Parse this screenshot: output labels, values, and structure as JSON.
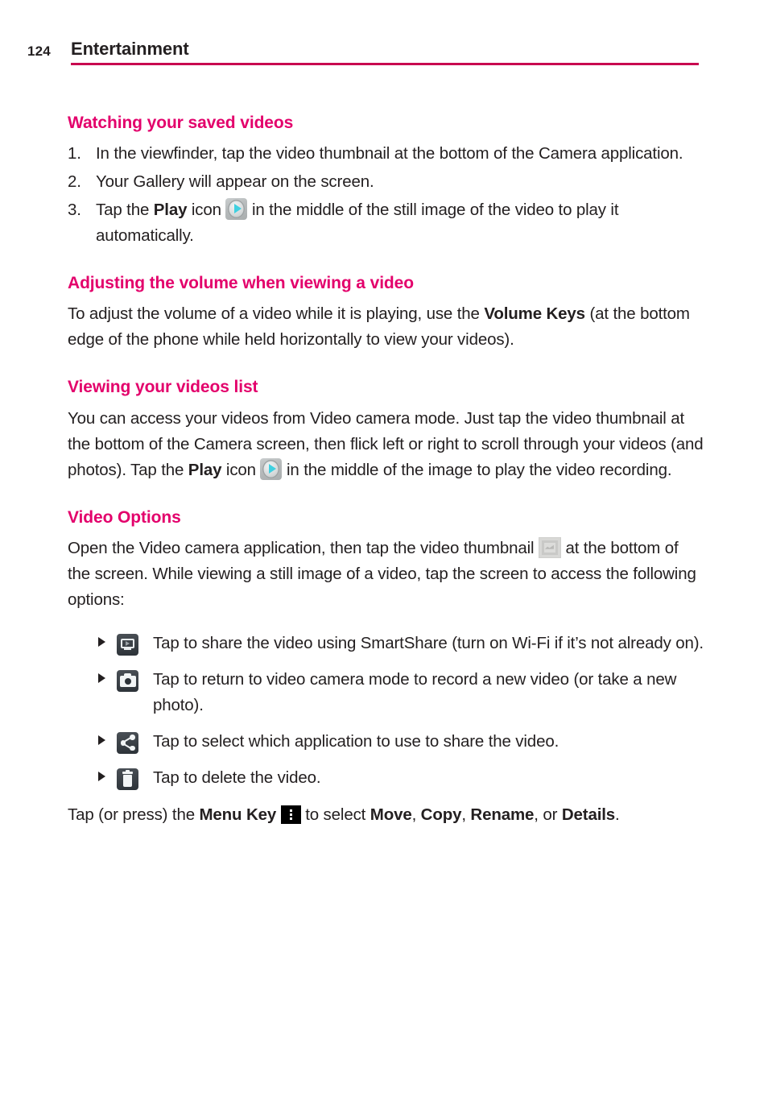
{
  "header": {
    "page_number": "124",
    "chapter_title": "Entertainment",
    "rule_color": "#c8024f"
  },
  "theme": {
    "heading_color": "#e3006b",
    "body_color": "#231f20",
    "background": "#ffffff"
  },
  "sections": {
    "watching": {
      "heading": "Watching your saved videos",
      "steps": [
        {
          "num": "1.",
          "text": "In the viewfinder, tap the video thumbnail at the bottom of the Camera application."
        },
        {
          "num": "2.",
          "text": "Your Gallery will appear on the screen."
        },
        {
          "num": "3.",
          "text_before": "Tap the ",
          "bold": "Play",
          "text_mid": " icon ",
          "icon": "play-icon",
          "text_after": " in the middle of the still image of the video to play it automatically."
        }
      ]
    },
    "volume": {
      "heading": "Adjusting the volume when viewing a video",
      "text_before": "To adjust the volume of a video while it is playing, use the ",
      "bold": "Volume Keys",
      "text_after": " (at the bottom edge of the phone while held horizontally to view your videos)."
    },
    "viewing_list": {
      "heading": "Viewing your videos list",
      "text_before": "You can access your videos from Video camera mode. Just tap the video thumbnail at the bottom of the Camera screen, then flick left or right to scroll through your videos (and photos). Tap the ",
      "bold": "Play",
      "text_mid": " icon ",
      "icon": "play-icon",
      "text_after": " in the middle of the image to play the video recording."
    },
    "video_options": {
      "heading": "Video Options",
      "intro_before": "Open the Video camera application, then tap the video thumbnail ",
      "intro_icon": "video-thumbnail-icon",
      "intro_after": " at the bottom of the screen. While viewing a still image of a video, tap the screen to access the following options:",
      "options": [
        {
          "icon": "smartshare-icon",
          "text": "Tap to share the video using SmartShare (turn on Wi-Fi if it’s not already on)."
        },
        {
          "icon": "camera-icon",
          "text": "Tap to return to video camera mode to record a new video (or take a new photo)."
        },
        {
          "icon": "share-icon",
          "text": "Tap to select which application to use to share the video."
        },
        {
          "icon": "trash-icon",
          "text": "Tap to delete the video."
        }
      ],
      "footer": {
        "text_1": "Tap (or press) the ",
        "bold_1": "Menu Key",
        "icon": "menu-key-icon",
        "text_2": " to select ",
        "bold_2": "Move",
        "text_3": ", ",
        "bold_3": "Copy",
        "text_4": ", ",
        "bold_4": "Rename",
        "text_5": ", or ",
        "bold_5": "Details",
        "text_6": "."
      }
    }
  }
}
